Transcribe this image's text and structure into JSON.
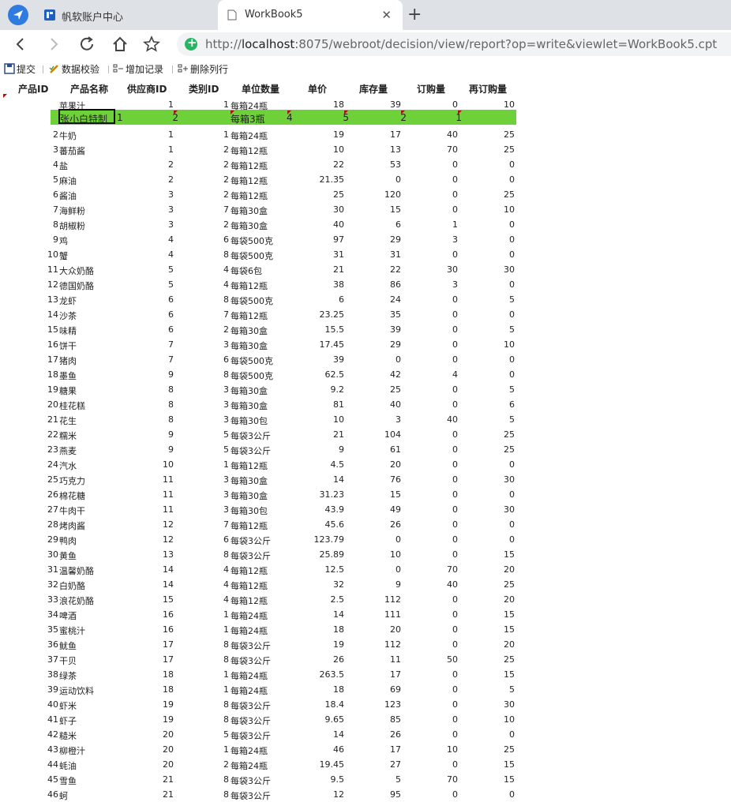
{
  "browser": {
    "tabs": [
      {
        "title": "帆软账户中心"
      },
      {
        "title": "WorkBook5"
      }
    ],
    "url_prefix": "http://",
    "url_host": "localhost",
    "url_rest": ":8075/webroot/decision/view/report?op=write&viewlet=WorkBook5.cpt"
  },
  "toolbar": {
    "submit": "提交",
    "validate": "数据校验",
    "add_record": "增加记录",
    "delete_row": "删除列行"
  },
  "table": {
    "headers": [
      "产品ID",
      "产品名称",
      "供应商ID",
      "类别ID",
      "单位数量",
      "单价",
      "库存量",
      "订购量",
      "再订购量"
    ],
    "edit_row": {
      "name": "张小白特制",
      "supplier": "2",
      "unit": "每箱3瓶",
      "category": "4",
      "price": "5",
      "stock": "2",
      "order": "1",
      "prefix": "1"
    },
    "rows": [
      [
        "",
        "苹果汁",
        "1",
        "1",
        "每箱24瓶",
        "18",
        "39",
        "0",
        "10"
      ],
      [
        "2",
        "牛奶",
        "1",
        "1",
        "每箱24瓶",
        "19",
        "17",
        "40",
        "25"
      ],
      [
        "3",
        "蕃茄酱",
        "1",
        "2",
        "每箱12瓶",
        "10",
        "13",
        "70",
        "25"
      ],
      [
        "4",
        "盐",
        "2",
        "2",
        "每箱12瓶",
        "22",
        "53",
        "0",
        "0"
      ],
      [
        "5",
        "麻油",
        "2",
        "2",
        "每箱12瓶",
        "21.35",
        "0",
        "0",
        "0"
      ],
      [
        "6",
        "酱油",
        "3",
        "2",
        "每箱12瓶",
        "25",
        "120",
        "0",
        "25"
      ],
      [
        "7",
        "海鲜粉",
        "3",
        "7",
        "每箱30盒",
        "30",
        "15",
        "0",
        "10"
      ],
      [
        "8",
        "胡椒粉",
        "3",
        "2",
        "每箱30盒",
        "40",
        "6",
        "1",
        "0"
      ],
      [
        "9",
        "鸡",
        "4",
        "6",
        "每袋500克",
        "97",
        "29",
        "3",
        "0"
      ],
      [
        "10",
        "蟹",
        "4",
        "8",
        "每袋500克",
        "31",
        "31",
        "0",
        "0"
      ],
      [
        "11",
        "大众奶酪",
        "5",
        "4",
        "每袋6包",
        "21",
        "22",
        "30",
        "30"
      ],
      [
        "12",
        "德国奶酪",
        "5",
        "4",
        "每箱12瓶",
        "38",
        "86",
        "3",
        "0"
      ],
      [
        "13",
        "龙虾",
        "6",
        "8",
        "每袋500克",
        "6",
        "24",
        "0",
        "5"
      ],
      [
        "14",
        "沙茶",
        "6",
        "7",
        "每箱12瓶",
        "23.25",
        "35",
        "0",
        "0"
      ],
      [
        "15",
        "味精",
        "6",
        "2",
        "每箱30盒",
        "15.5",
        "39",
        "0",
        "5"
      ],
      [
        "16",
        "饼干",
        "7",
        "3",
        "每箱30盒",
        "17.45",
        "29",
        "0",
        "10"
      ],
      [
        "17",
        "猪肉",
        "7",
        "6",
        "每袋500克",
        "39",
        "0",
        "0",
        "0"
      ],
      [
        "18",
        "墨鱼",
        "9",
        "8",
        "每袋500克",
        "62.5",
        "42",
        "4",
        "0"
      ],
      [
        "19",
        "糖果",
        "8",
        "3",
        "每箱30盒",
        "9.2",
        "25",
        "0",
        "5"
      ],
      [
        "20",
        "桂花糕",
        "8",
        "3",
        "每箱30盒",
        "81",
        "40",
        "0",
        "6"
      ],
      [
        "21",
        "花生",
        "8",
        "3",
        "每箱30包",
        "10",
        "3",
        "40",
        "5"
      ],
      [
        "22",
        "糯米",
        "9",
        "5",
        "每袋3公斤",
        "21",
        "104",
        "0",
        "25"
      ],
      [
        "23",
        "燕麦",
        "9",
        "5",
        "每袋3公斤",
        "9",
        "61",
        "0",
        "25"
      ],
      [
        "24",
        "汽水",
        "10",
        "1",
        "每箱12瓶",
        "4.5",
        "20",
        "0",
        "0"
      ],
      [
        "25",
        "巧克力",
        "11",
        "3",
        "每箱30盒",
        "14",
        "76",
        "0",
        "30"
      ],
      [
        "26",
        "棉花糖",
        "11",
        "3",
        "每箱30盒",
        "31.23",
        "15",
        "0",
        "0"
      ],
      [
        "27",
        "牛肉干",
        "11",
        "3",
        "每箱30包",
        "43.9",
        "49",
        "0",
        "30"
      ],
      [
        "28",
        "烤肉酱",
        "12",
        "7",
        "每箱12瓶",
        "45.6",
        "26",
        "0",
        "0"
      ],
      [
        "29",
        "鸭肉",
        "12",
        "6",
        "每袋3公斤",
        "123.79",
        "0",
        "0",
        "0"
      ],
      [
        "30",
        "黄鱼",
        "13",
        "8",
        "每袋3公斤",
        "25.89",
        "10",
        "0",
        "15"
      ],
      [
        "31",
        "温馨奶酪",
        "14",
        "4",
        "每箱12瓶",
        "12.5",
        "0",
        "70",
        "20"
      ],
      [
        "32",
        "白奶酪",
        "14",
        "4",
        "每箱12瓶",
        "32",
        "9",
        "40",
        "25"
      ],
      [
        "33",
        "浪花奶酪",
        "15",
        "4",
        "每箱12瓶",
        "2.5",
        "112",
        "0",
        "20"
      ],
      [
        "34",
        "啤酒",
        "16",
        "1",
        "每箱24瓶",
        "14",
        "111",
        "0",
        "15"
      ],
      [
        "35",
        "蜜桃汁",
        "16",
        "1",
        "每箱24瓶",
        "18",
        "20",
        "0",
        "15"
      ],
      [
        "36",
        "鱿鱼",
        "17",
        "8",
        "每袋3公斤",
        "19",
        "112",
        "0",
        "20"
      ],
      [
        "37",
        "干贝",
        "17",
        "8",
        "每袋3公斤",
        "26",
        "11",
        "50",
        "25"
      ],
      [
        "38",
        "绿茶",
        "18",
        "1",
        "每箱24瓶",
        "263.5",
        "17",
        "0",
        "15"
      ],
      [
        "39",
        "运动饮料",
        "18",
        "1",
        "每箱24瓶",
        "18",
        "69",
        "0",
        "5"
      ],
      [
        "40",
        "虾米",
        "19",
        "8",
        "每袋3公斤",
        "18.4",
        "123",
        "0",
        "30"
      ],
      [
        "41",
        "虾子",
        "19",
        "8",
        "每袋3公斤",
        "9.65",
        "85",
        "0",
        "10"
      ],
      [
        "42",
        "糙米",
        "20",
        "5",
        "每袋3公斤",
        "14",
        "26",
        "0",
        "0"
      ],
      [
        "43",
        "柳橙汁",
        "20",
        "1",
        "每箱24瓶",
        "46",
        "17",
        "10",
        "25"
      ],
      [
        "44",
        "蚝油",
        "20",
        "2",
        "每箱24瓶",
        "19.45",
        "27",
        "0",
        "15"
      ],
      [
        "45",
        "雪鱼",
        "21",
        "8",
        "每袋3公斤",
        "9.5",
        "5",
        "70",
        "15"
      ],
      [
        "46",
        "蚵",
        "21",
        "8",
        "每袋3公斤",
        "12",
        "95",
        "0",
        "0"
      ]
    ]
  }
}
